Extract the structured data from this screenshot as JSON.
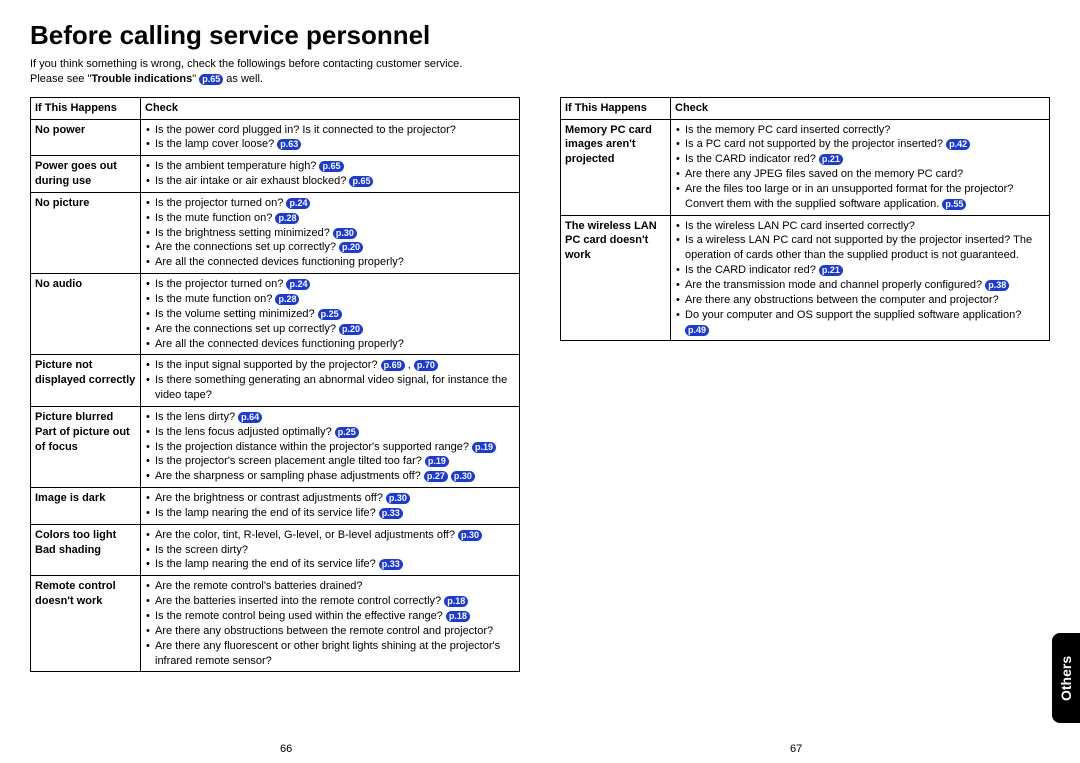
{
  "title": "Before calling service personnel",
  "intro_line1": "If you think something is wrong, check the followings before contacting customer service.",
  "intro_line2a": "Please see \"",
  "intro_line2b": "Trouble indications",
  "intro_line2c": "\" ",
  "intro_line2d": " as well.",
  "intro_ref": "p.65",
  "header_happens": "If This Happens",
  "header_check": "Check",
  "left_rows": [
    {
      "happens": "No power",
      "items": [
        {
          "text": "Is the power cord plugged in? Is it connected to the projector?"
        },
        {
          "text": "Is the lamp cover loose? ",
          "refs": [
            "p.63"
          ]
        }
      ]
    },
    {
      "happens": "Power goes out during use",
      "items": [
        {
          "text": "Is the ambient temperature high? ",
          "refs": [
            "p.65"
          ]
        },
        {
          "text": "Is the air intake or air exhaust blocked? ",
          "refs": [
            "p.65"
          ]
        }
      ]
    },
    {
      "happens": "No picture",
      "items": [
        {
          "text": "Is the projector turned on? ",
          "refs": [
            "p.24"
          ]
        },
        {
          "text": "Is the mute function on? ",
          "refs": [
            "p.28"
          ]
        },
        {
          "text": "Is the brightness setting minimized? ",
          "refs": [
            "p.30"
          ]
        },
        {
          "text": "Are the connections set up correctly? ",
          "refs": [
            "p.20"
          ]
        },
        {
          "text": "Are all the connected devices functioning properly?"
        }
      ]
    },
    {
      "happens": "No audio",
      "items": [
        {
          "text": "Is the projector turned on? ",
          "refs": [
            "p.24"
          ]
        },
        {
          "text": "Is the mute function on? ",
          "refs": [
            "p.28"
          ]
        },
        {
          "text": "Is the volume setting minimized? ",
          "refs": [
            "p.25"
          ]
        },
        {
          "text": "Are the connections set up correctly? ",
          "refs": [
            "p.20"
          ]
        },
        {
          "text": "Are all the connected devices functioning properly?"
        }
      ]
    },
    {
      "happens": "Picture not displayed correctly",
      "items": [
        {
          "text": "Is the input signal supported by the projector? ",
          "refs": [
            "p.69"
          ],
          "mid": " , ",
          "refs2": [
            "p.70"
          ]
        },
        {
          "text": "Is there something generating an abnormal video signal, for instance the video tape?"
        }
      ]
    },
    {
      "happens": "Picture blurred Part of picture out of focus",
      "items": [
        {
          "text": "Is the lens dirty? ",
          "refs": [
            "p.64"
          ]
        },
        {
          "text": "Is the lens focus adjusted optimally? ",
          "refs": [
            "p.25"
          ]
        },
        {
          "text": "Is the projection distance within the projector's supported range? ",
          "refs": [
            "p.19"
          ]
        },
        {
          "text": "Is the projector's screen placement angle tilted too far? ",
          "refs": [
            "p.19"
          ]
        },
        {
          "text": "Are the sharpness or sampling phase adjustments off? ",
          "refs": [
            "p.27"
          ],
          "mid": " ",
          "refs2": [
            "p.30"
          ]
        }
      ]
    },
    {
      "happens": "Image is dark",
      "items": [
        {
          "text": "Are the brightness or contrast adjustments off? ",
          "refs": [
            "p.30"
          ]
        },
        {
          "text": "Is the lamp nearing the end of its service life? ",
          "refs": [
            "p.33"
          ]
        }
      ]
    },
    {
      "happens": "Colors too light Bad shading",
      "items": [
        {
          "text": "Are the color, tint, R-level, G-level, or B-level adjustments off? ",
          "refs": [
            "p.30"
          ]
        },
        {
          "text": "Is the screen dirty?"
        },
        {
          "text": "Is the lamp nearing the end of its service life? ",
          "refs": [
            "p.33"
          ]
        }
      ]
    },
    {
      "happens": "Remote control doesn't work",
      "items": [
        {
          "text": "Are the remote control's batteries drained?"
        },
        {
          "text": "Are the batteries inserted into the remote control correctly? ",
          "refs": [
            "p.18"
          ]
        },
        {
          "text": "Is the remote control being used within the effective range? ",
          "refs": [
            "p.18"
          ]
        },
        {
          "text": "Are there any obstructions between the remote control and projector?"
        },
        {
          "text": "Are there any fluorescent or other bright lights shining at the projector's infrared remote sensor?"
        }
      ]
    }
  ],
  "right_rows": [
    {
      "happens": "Memory PC card images aren't projected",
      "items": [
        {
          "text": "Is the memory PC card inserted correctly?"
        },
        {
          "text": "Is a PC card not supported by the projector inserted? ",
          "refs": [
            "p.42"
          ]
        },
        {
          "text": "Is the CARD indicator red? ",
          "refs": [
            "p.21"
          ]
        },
        {
          "text": "Are there any JPEG files saved on the memory PC card?"
        },
        {
          "text": "Are the files too large or in an unsupported format for the projector? Convert them with the supplied software application. ",
          "refs": [
            "p.55"
          ]
        }
      ]
    },
    {
      "happens": "The wireless LAN PC card doesn't work",
      "items": [
        {
          "text": "Is the wireless LAN PC card inserted correctly?"
        },
        {
          "text": "Is a wireless LAN PC card not supported by the projector inserted? The operation of cards other than the supplied product is not guaranteed."
        },
        {
          "text": "Is the CARD indicator red? ",
          "refs": [
            "p.21"
          ]
        },
        {
          "text": "Are the transmission mode and channel properly configured? ",
          "refs": [
            "p.38"
          ]
        },
        {
          "text": "Are there any obstructions between the computer and projector?"
        },
        {
          "text": "Do your computer and OS support the supplied software application? ",
          "refs": [
            "p.49"
          ]
        }
      ]
    }
  ],
  "page_left": "66",
  "page_right": "67",
  "side_tab": "Others"
}
